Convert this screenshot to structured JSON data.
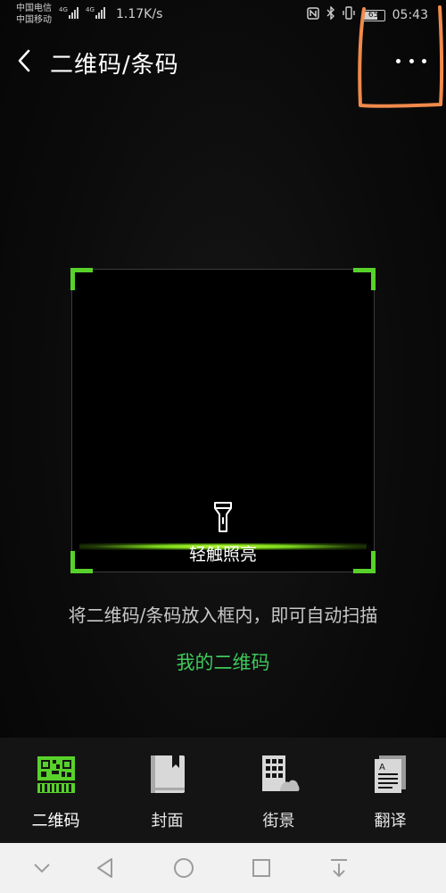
{
  "status_bar": {
    "carrier_1": "中国电信",
    "carrier_2": "中国移动",
    "network_1": "4G",
    "network_2": "4G",
    "speed": "1.17K/s",
    "battery": "65",
    "time": "05:43"
  },
  "header": {
    "title": "二维码/条码"
  },
  "scanner": {
    "flash_label": "轻触照亮",
    "hint": "将二维码/条码放入框内，即可自动扫描",
    "my_qrcode": "我的二维码"
  },
  "tabs": [
    {
      "label": "二维码",
      "icon": "qrcode-icon",
      "active": true
    },
    {
      "label": "封面",
      "icon": "book-cover-icon",
      "active": false
    },
    {
      "label": "街景",
      "icon": "street-view-icon",
      "active": false
    },
    {
      "label": "翻译",
      "icon": "translate-icon",
      "active": false
    }
  ],
  "colors": {
    "accent": "#58d22a",
    "link": "#3ec95b",
    "annotation": "#f08a4b"
  }
}
